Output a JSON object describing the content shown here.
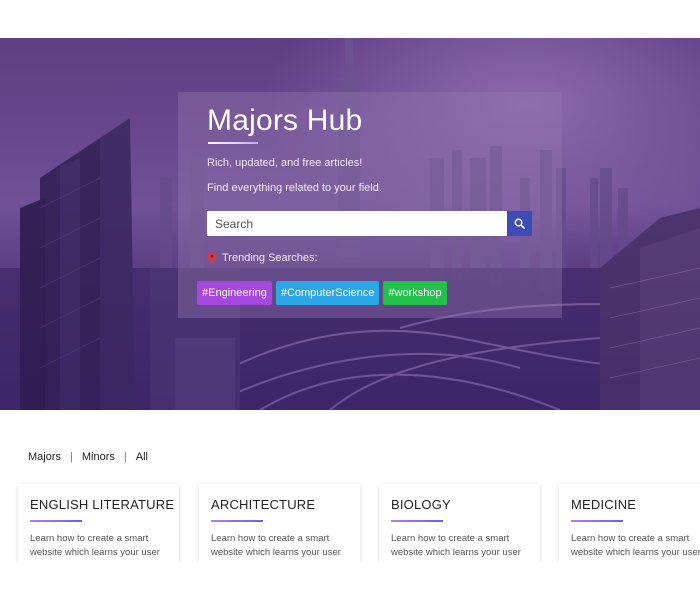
{
  "hero": {
    "title": "Majors Hub",
    "tagline_1": "Rich, updated, and free articles!",
    "tagline_2": "Find everything related to your field.",
    "search": {
      "placeholder": "Search",
      "button_icon": "search-icon"
    },
    "trending_label": "Trending Searches:",
    "trending_icon": "map-pin-icon",
    "tags": [
      {
        "label": "#Engineering",
        "color": "#a548e0"
      },
      {
        "label": "#ComputerScience",
        "color": "#2ba6e6"
      },
      {
        "label": "#workshop",
        "color": "#22c24a"
      }
    ]
  },
  "filter": {
    "items": [
      "Majors",
      "Minors",
      "All"
    ]
  },
  "cards": [
    {
      "title": "ENGLISH LITERATURE",
      "description": "Learn how to create a smart website which learns your user"
    },
    {
      "title": "ARCHITECTURE",
      "description": "Learn how to create a smart website which learns your user"
    },
    {
      "title": "BIOLOGY",
      "description": "Learn how to create a smart website which learns your user"
    },
    {
      "title": "MEDICINE",
      "description": "Learn how to create a smart website which learns your user"
    }
  ],
  "colors": {
    "accent": "#3f4cb8",
    "underline_gradient": [
      "#b57bff",
      "#6a5cf0"
    ]
  }
}
